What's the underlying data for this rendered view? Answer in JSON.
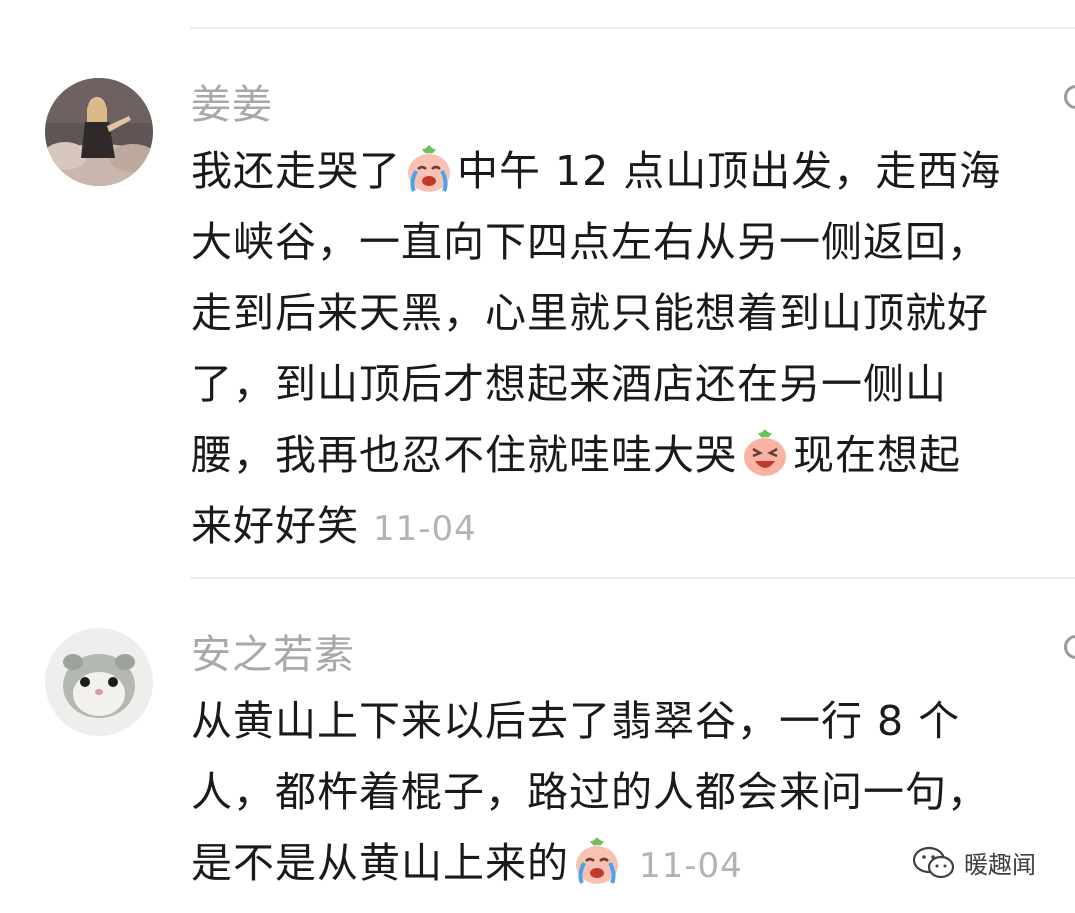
{
  "comments": [
    {
      "username": "姜姜",
      "avatar_icon": "user-photo-woman-sitting-icon",
      "lines": [
        {
          "a": "我还走哭了",
          "emoji": "crying-peach-emoji",
          "b": "中午 12 点山顶出发，走西海"
        },
        {
          "a": "大峡谷，一直向下四点左右从另一侧返回，"
        },
        {
          "a": "走到后来天黑，心里就只能想着到山顶就好"
        },
        {
          "a": "了，到山顶后才想起来酒店还在另一侧山"
        },
        {
          "a": "腰，我再也忍不住就哇哇大哭",
          "emoji": "laughing-peach-emoji",
          "b": "现在想起"
        },
        {
          "a": "来好好笑"
        }
      ],
      "timestamp": "11-04"
    },
    {
      "username": "安之若素",
      "avatar_icon": "user-photo-hamster-toy-icon",
      "lines": [
        {
          "a": "从黄山上下来以后去了翡翠谷，一行 8 个"
        },
        {
          "a": "人，都杵着棍子，路过的人都会来问一句，"
        },
        {
          "a": "是不是从黄山上来的",
          "emoji": "crying-peach-emoji"
        }
      ],
      "timestamp": "11-04"
    }
  ],
  "watermark": {
    "text": "暖趣闻",
    "icon": "wechat-official-account-icon"
  },
  "colors": {
    "username": "#a8a8a8",
    "body": "#1a1a1a",
    "timestamp": "#b3b3b3",
    "divider": "#ededed"
  }
}
